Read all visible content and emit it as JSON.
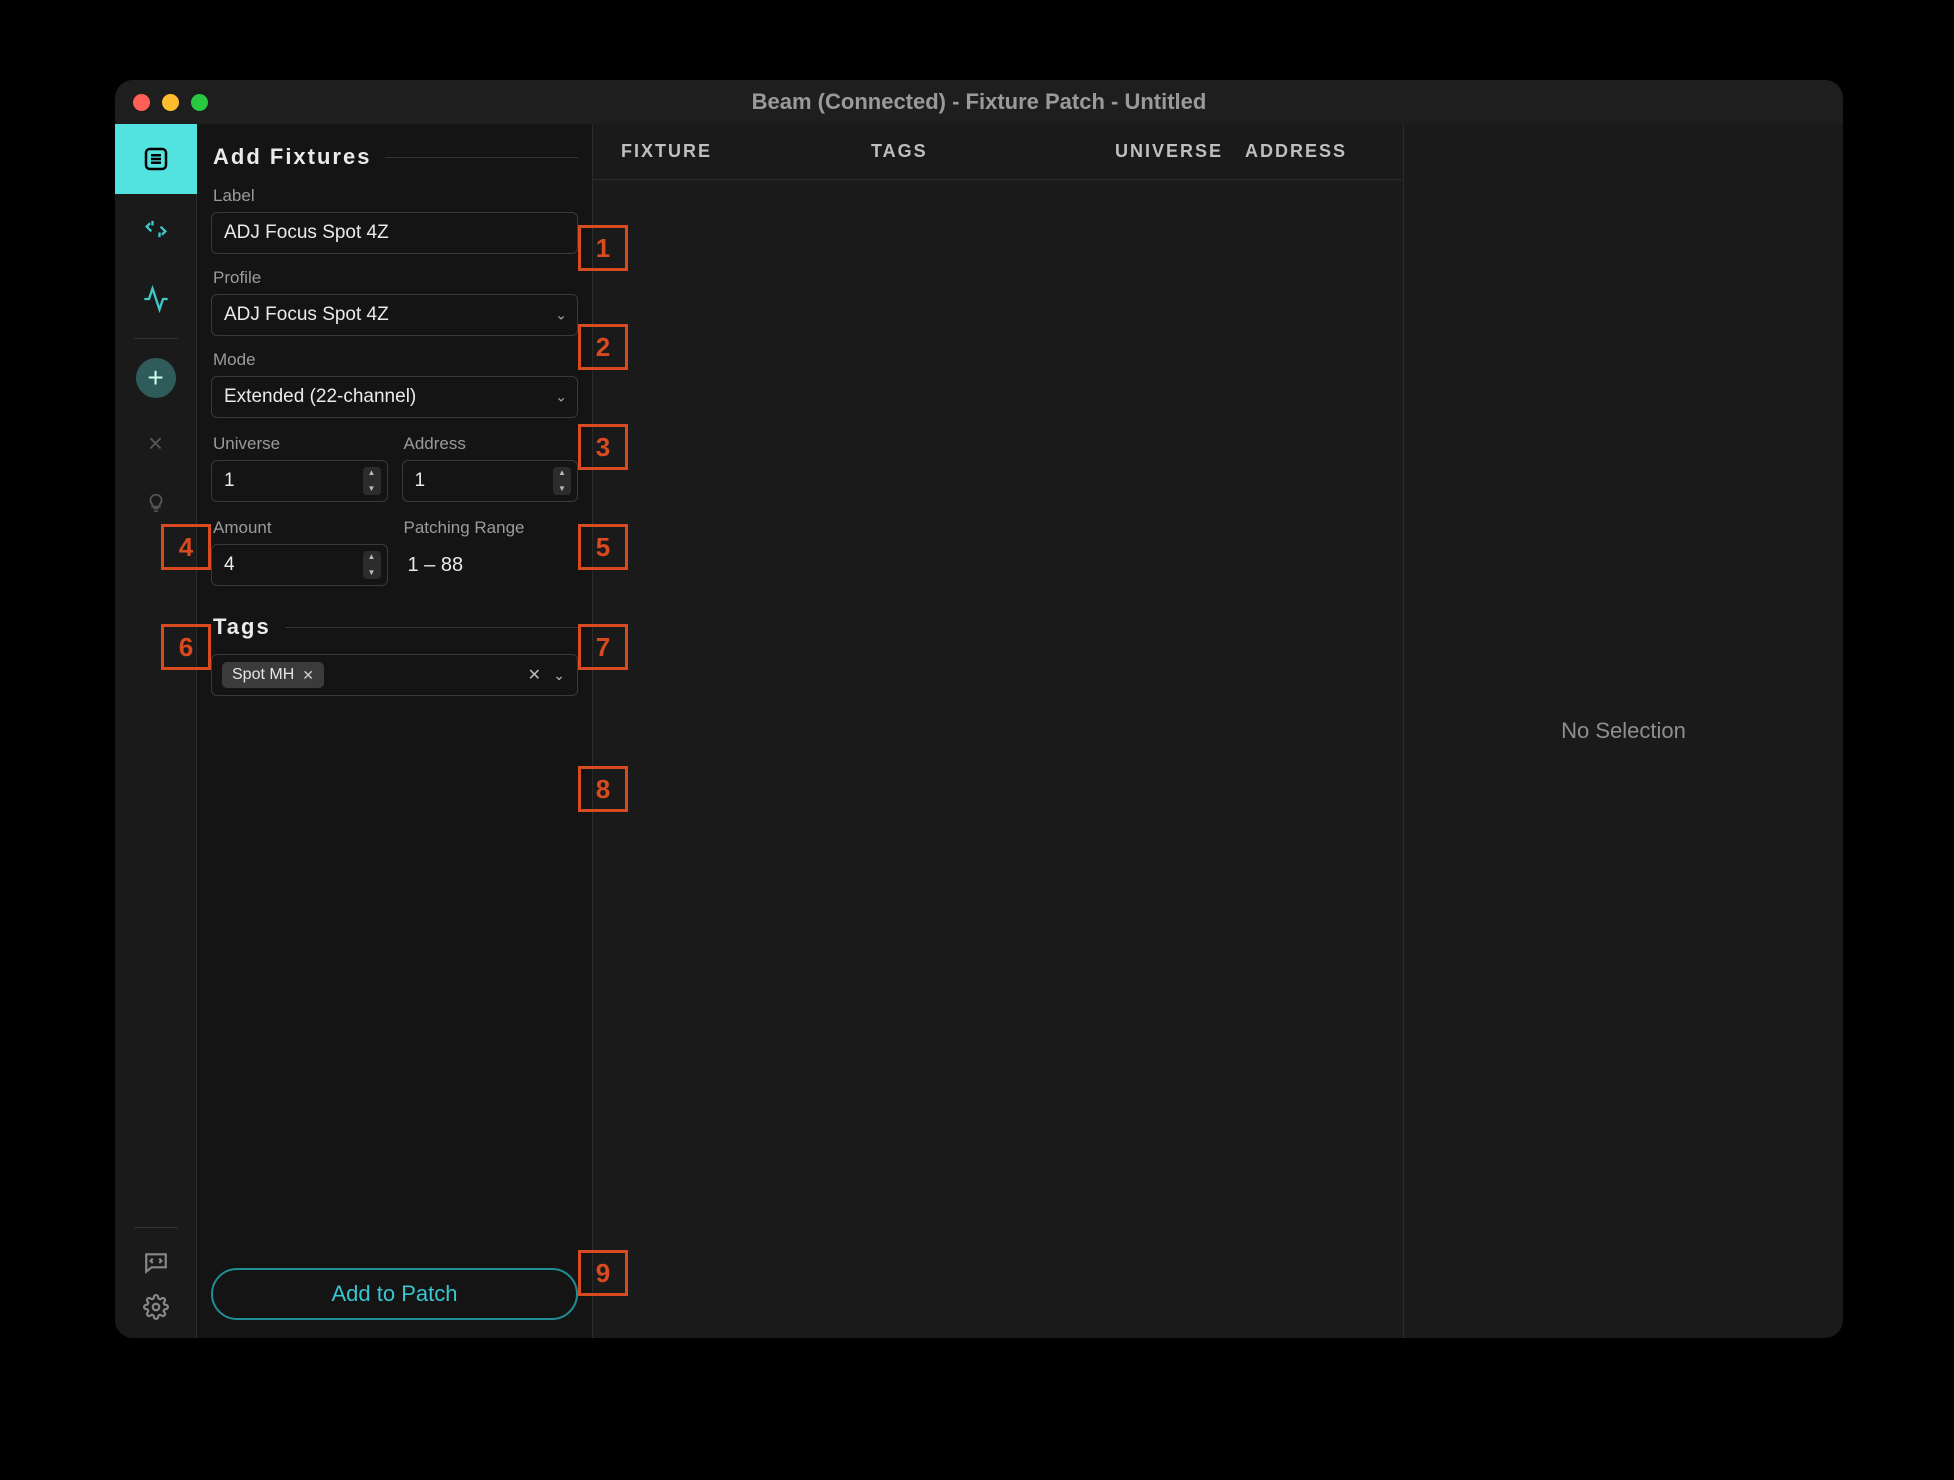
{
  "window": {
    "title": "Beam (Connected) - Fixture Patch - Untitled"
  },
  "rail": {
    "items": [
      "fixtures",
      "patch",
      "activity"
    ],
    "close_icon": "×",
    "bulb_icon": "bulb"
  },
  "panel": {
    "heading": "Add Fixtures",
    "label_label": "Label",
    "label_value": "ADJ Focus Spot 4Z",
    "profile_label": "Profile",
    "profile_value": "ADJ Focus Spot 4Z",
    "mode_label": "Mode",
    "mode_value": "Extended (22-channel)",
    "universe_label": "Universe",
    "universe_value": "1",
    "address_label": "Address",
    "address_value": "1",
    "amount_label": "Amount",
    "amount_value": "4",
    "range_label": "Patching Range",
    "range_value": "1 – 88",
    "tags_heading": "Tags",
    "tag_chip": "Spot MH",
    "add_button": "Add to Patch"
  },
  "table": {
    "col_fixture": "FIXTURE",
    "col_tags": "TAGS",
    "col_universe": "UNIVERSE",
    "col_address": "ADDRESS"
  },
  "detail": {
    "empty": "No Selection"
  },
  "annotations": {
    "1": "1",
    "2": "2",
    "3": "3",
    "4": "4",
    "5": "5",
    "6": "6",
    "7": "7",
    "8": "8",
    "9": "9"
  }
}
